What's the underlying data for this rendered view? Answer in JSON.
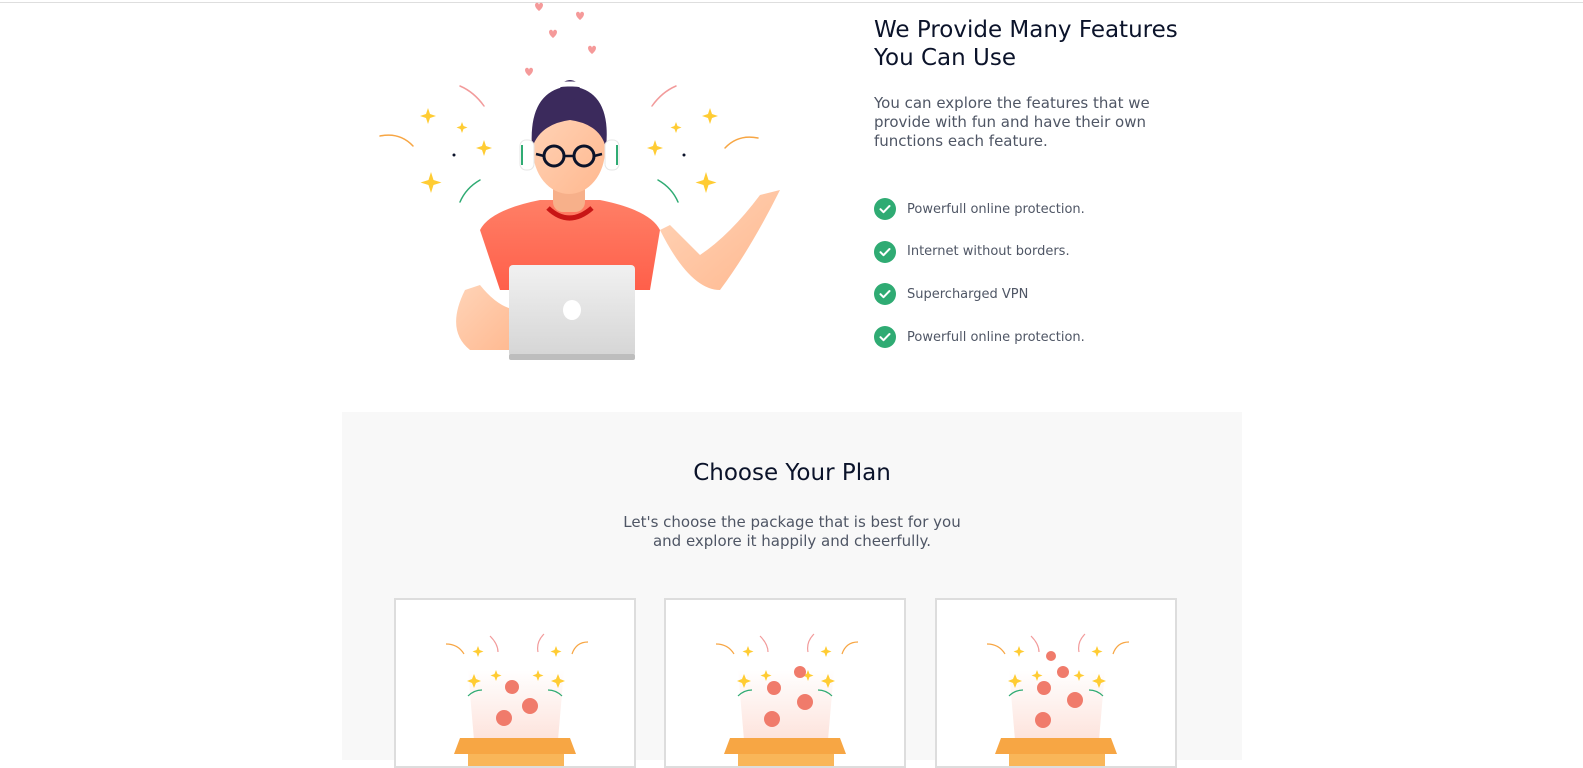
{
  "features": {
    "title_line1": "We Provide Many Features",
    "title_line2": "You Can Use",
    "description": "You can explore the features that we provide with fun and have their own functions each feature.",
    "items": [
      {
        "label": "Powerfull online protection."
      },
      {
        "label": "Internet without borders."
      },
      {
        "label": "Supercharged VPN"
      },
      {
        "label": "Powerfull online protection."
      }
    ],
    "check_color": "#2fab73",
    "check_icon": "check-circle-icon"
  },
  "plans": {
    "title": "Choose Your Plan",
    "subtitle_line1": "Let's choose the package that is best for you",
    "subtitle_line2": "and explore it happily and cheerfully."
  },
  "colors": {
    "heading": "#0b132a",
    "body_text": "#4f5665",
    "section_bg": "#f8f8f8",
    "accent_red": "#f53838",
    "box_orange": "#f7a644"
  }
}
